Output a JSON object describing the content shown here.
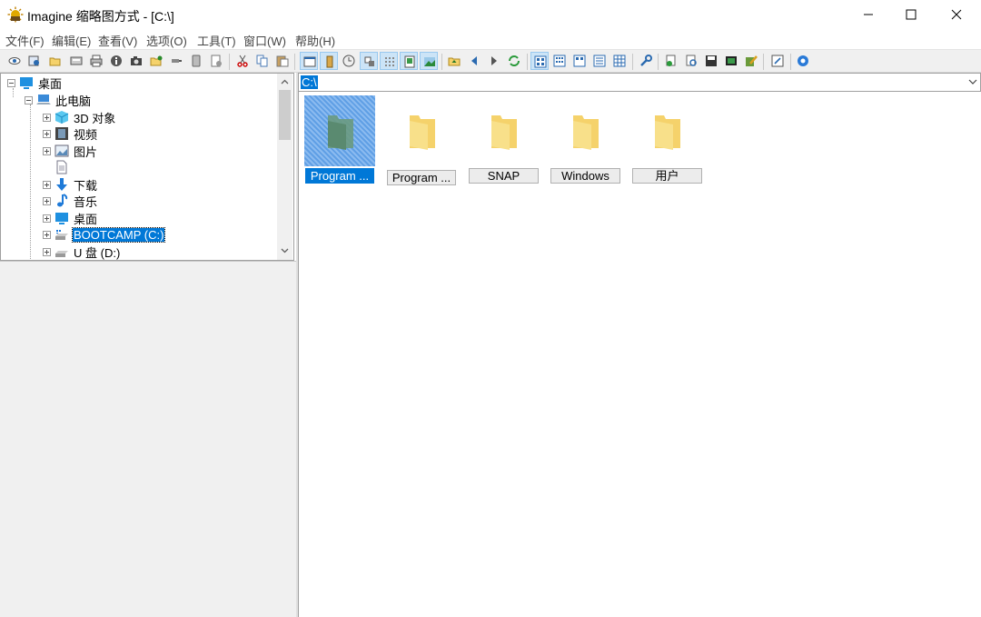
{
  "window": {
    "title": "Imagine 缩略图方式 - [C:\\]",
    "icon": "sun-app-icon",
    "controls": [
      "minimize-icon",
      "maximize-icon",
      "close-icon"
    ]
  },
  "menu": [
    "文件(F)",
    "编辑(E)",
    "查看(V)",
    "选项(O)",
    "工具(T)",
    "窗口(W)",
    "帮助(H)"
  ],
  "toolbar": {
    "buttons": [
      "view",
      "open",
      "folder-open",
      "scan",
      "print",
      "info",
      "camera",
      "folder-star",
      "usb",
      "disk",
      "properties",
      "cut",
      "copy",
      "paste",
      "window",
      "filmstrip",
      "refresh",
      "tag",
      "grid",
      "frame",
      "image",
      "folder-up",
      "back",
      "forward",
      "reload",
      "thumbs-large",
      "thumbs-medium",
      "thumbs-small",
      "list",
      "details",
      "tools",
      "add-image",
      "zoom",
      "save",
      "slideshow",
      "edit",
      "help"
    ]
  },
  "tree": {
    "items": [
      {
        "label": "桌面",
        "icon": "desktop-icon"
      },
      {
        "label": "此电脑",
        "icon": "computer-icon"
      },
      {
        "label": "3D 对象",
        "icon": "cube-icon"
      },
      {
        "label": "视频",
        "icon": "film-icon"
      },
      {
        "label": "图片",
        "icon": "picture-icon"
      },
      {
        "label": "",
        "icon": "document-icon"
      },
      {
        "label": "下载",
        "icon": "download-icon"
      },
      {
        "label": "音乐",
        "icon": "music-icon"
      },
      {
        "label": "桌面",
        "icon": "desktop-icon"
      },
      {
        "label": "BOOTCAMP (C:)",
        "icon": "drive-icon",
        "selected": true
      },
      {
        "label": "U 盘 (D:)",
        "icon": "drive-icon"
      }
    ]
  },
  "path": {
    "value": "C:\\"
  },
  "thumbnails": [
    {
      "label": "Program ...",
      "selected": true
    },
    {
      "label": "Program ...",
      "selected": false
    },
    {
      "label": "SNAP",
      "selected": false
    },
    {
      "label": "Windows",
      "selected": false
    },
    {
      "label": "用户",
      "selected": false
    }
  ],
  "colors": {
    "selection": "#0078d7",
    "folder": "#f5d26b",
    "toolbar_bg": "#f0f0f0"
  }
}
